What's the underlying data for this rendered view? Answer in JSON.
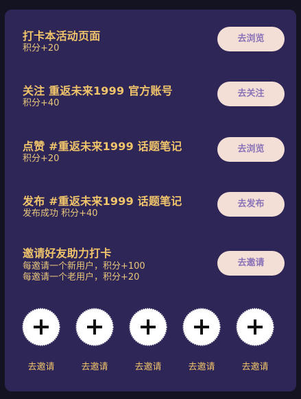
{
  "tasks": [
    {
      "title": "打卡本活动页面",
      "desc": [
        "积分+20"
      ],
      "button": "去浏览"
    },
    {
      "title": "关注 重返未来1999 官方账号",
      "desc": [
        "积分+40"
      ],
      "button": "去关注"
    },
    {
      "title": "点赞 #重返未来1999 话题笔记",
      "desc": [
        "积分+20"
      ],
      "button": "去浏览"
    },
    {
      "title": "发布 #重返未来1999 话题笔记",
      "desc": [
        "发布成功 积分+40"
      ],
      "button": "去发布"
    },
    {
      "title": "邀请好友助力打卡",
      "desc": [
        "每邀请一个新用户，积分+100",
        "每邀请一个老用户，积分+20"
      ],
      "button": "去邀请"
    }
  ],
  "invite_slots": [
    {
      "label": "去邀请",
      "icon": "plus-icon"
    },
    {
      "label": "去邀请",
      "icon": "plus-icon"
    },
    {
      "label": "去邀请",
      "icon": "plus-icon"
    },
    {
      "label": "去邀请",
      "icon": "plus-icon"
    },
    {
      "label": "去邀请",
      "icon": "plus-icon"
    }
  ],
  "colors": {
    "background": "#141322",
    "panel": "#2f2658",
    "title_text": "#f0c46a",
    "button_bg": "#f3dfd5",
    "button_text": "#8a73b8"
  }
}
